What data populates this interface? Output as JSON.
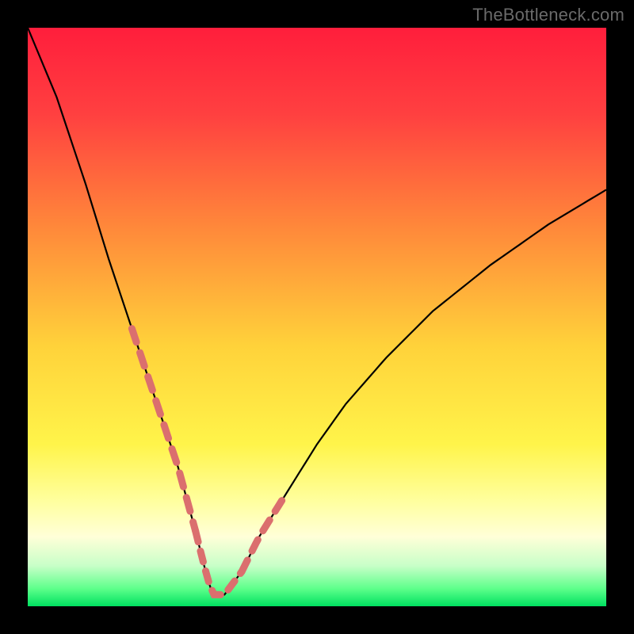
{
  "watermark": {
    "text": "TheBottleneck.com"
  },
  "colors": {
    "frame": "#000000",
    "curve": "#000000",
    "dash": "#db6f6e",
    "gradient_stops": [
      {
        "offset": 0.0,
        "color": "#ff1e3c"
      },
      {
        "offset": 0.15,
        "color": "#ff4040"
      },
      {
        "offset": 0.35,
        "color": "#ff8a3a"
      },
      {
        "offset": 0.55,
        "color": "#ffd23a"
      },
      {
        "offset": 0.72,
        "color": "#fff44a"
      },
      {
        "offset": 0.82,
        "color": "#ffffa0"
      },
      {
        "offset": 0.88,
        "color": "#ffffd8"
      },
      {
        "offset": 0.93,
        "color": "#c8ffc8"
      },
      {
        "offset": 0.97,
        "color": "#5cff8a"
      },
      {
        "offset": 1.0,
        "color": "#00e060"
      }
    ]
  },
  "chart_data": {
    "type": "line",
    "title": "",
    "xlabel": "",
    "ylabel": "",
    "x_range": [
      0,
      100
    ],
    "y_range": [
      0,
      100
    ],
    "optimum_x": 32,
    "series": [
      {
        "name": "bottleneck-curve",
        "x": [
          0,
          5,
          10,
          14,
          18,
          22,
          26,
          29,
          31,
          32,
          34,
          37,
          40,
          45,
          50,
          55,
          62,
          70,
          80,
          90,
          100
        ],
        "y": [
          100,
          88,
          73,
          60,
          48,
          36,
          24,
          13,
          5,
          2,
          2,
          6,
          12,
          20,
          28,
          35,
          43,
          51,
          59,
          66,
          72
        ]
      }
    ],
    "dashed_segments": [
      {
        "x": [
          18,
          29
        ],
        "side": "left"
      },
      {
        "x": [
          29,
          37
        ],
        "side": "bottom"
      },
      {
        "x": [
          37,
          44
        ],
        "side": "right"
      }
    ]
  }
}
